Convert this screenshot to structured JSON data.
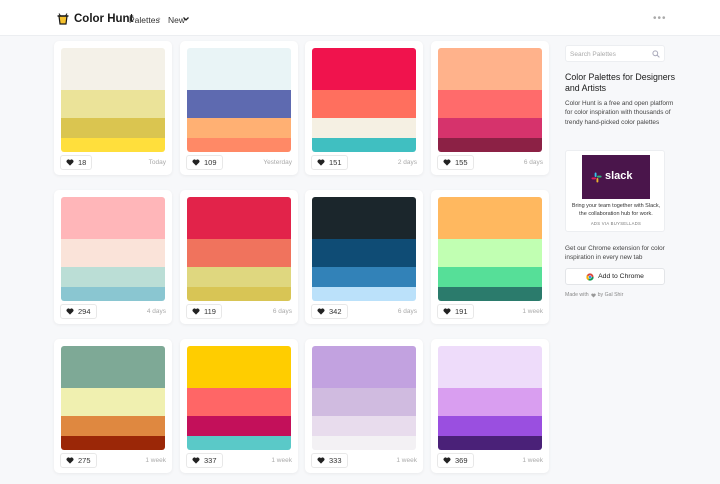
{
  "header": {
    "logo_text": "Color Hunt",
    "nav_palettes": "Palettes",
    "nav_separator": "›",
    "nav_new": "New",
    "more": "•••"
  },
  "cards": [
    {
      "likes": "18",
      "when": "Today",
      "colors": [
        "#f4f1e8",
        "#ebe399",
        "#dac550",
        "#ffdf3c"
      ],
      "heights": [
        42,
        28,
        20,
        14
      ]
    },
    {
      "likes": "109",
      "when": "Yesterday",
      "colors": [
        "#e9f4f6",
        "#5e6ab0",
        "#ffb073",
        "#ff8966"
      ],
      "heights": [
        42,
        28,
        20,
        14
      ]
    },
    {
      "likes": "151",
      "when": "2 days",
      "colors": [
        "#f0134d",
        "#ff6f5e",
        "#f5f0e3",
        "#40bfc1"
      ],
      "heights": [
        42,
        28,
        20,
        14
      ]
    },
    {
      "likes": "155",
      "when": "6 days",
      "colors": [
        "#ffb28b",
        "#ff6b6b",
        "#d6336c",
        "#8c2145"
      ],
      "heights": [
        42,
        28,
        20,
        14
      ]
    },
    {
      "likes": "294",
      "when": "4 days",
      "colors": [
        "#ffb6b9",
        "#fae3d9",
        "#bbded6",
        "#8ac6d1"
      ],
      "heights": [
        42,
        28,
        20,
        14
      ]
    },
    {
      "likes": "119",
      "when": "6 days",
      "colors": [
        "#e2234a",
        "#f0735d",
        "#dfd77f",
        "#d8c555"
      ],
      "heights": [
        42,
        28,
        20,
        14
      ]
    },
    {
      "likes": "342",
      "when": "6 days",
      "colors": [
        "#1b262c",
        "#0f4c75",
        "#3282b8",
        "#bbe1fa"
      ],
      "heights": [
        42,
        28,
        20,
        14
      ]
    },
    {
      "likes": "191",
      "when": "1 week",
      "colors": [
        "#ffb85f",
        "#c1ffb2",
        "#56df98",
        "#2b7b6c"
      ],
      "heights": [
        42,
        28,
        20,
        14
      ]
    },
    {
      "likes": "275",
      "when": "1 week",
      "colors": [
        "#7ea996",
        "#f0f0b0",
        "#df8840",
        "#9b2707"
      ],
      "heights": [
        42,
        28,
        20,
        14
      ]
    },
    {
      "likes": "337",
      "when": "1 week",
      "colors": [
        "#ffcd00",
        "#ff6666",
        "#c3105a",
        "#5ac9c8"
      ],
      "heights": [
        42,
        28,
        20,
        14
      ]
    },
    {
      "likes": "333",
      "when": "1 week",
      "colors": [
        "#c2a2e0",
        "#d0bbe0",
        "#e8dced",
        "#f3f1f4"
      ],
      "heights": [
        42,
        28,
        20,
        14
      ]
    },
    {
      "likes": "369",
      "when": "1 week",
      "colors": [
        "#eedcfa",
        "#d99ef0",
        "#9a4fe0",
        "#4a2178"
      ],
      "heights": [
        42,
        28,
        20,
        14
      ]
    }
  ],
  "sidebar": {
    "search_placeholder": "Search Palettes",
    "title": "Color Palettes for Designers and Artists",
    "description": "Color Hunt is a free and open platform for color inspiration with thousands of trendy hand-picked color palettes",
    "ad": {
      "brand": "slack",
      "text": "Bring your team together with Slack, the collaboration hub for work.",
      "via": "ADS VIA BUYSELLADS"
    },
    "extension_text": "Get our Chrome extension for color inspiration in every new tab",
    "chrome_button": "Add to Chrome",
    "made_with_prefix": "Made with",
    "made_with_suffix": "by Gal Shir"
  },
  "colors": {
    "background": "#f7f8fa",
    "slack_purple": "#4a154b"
  }
}
